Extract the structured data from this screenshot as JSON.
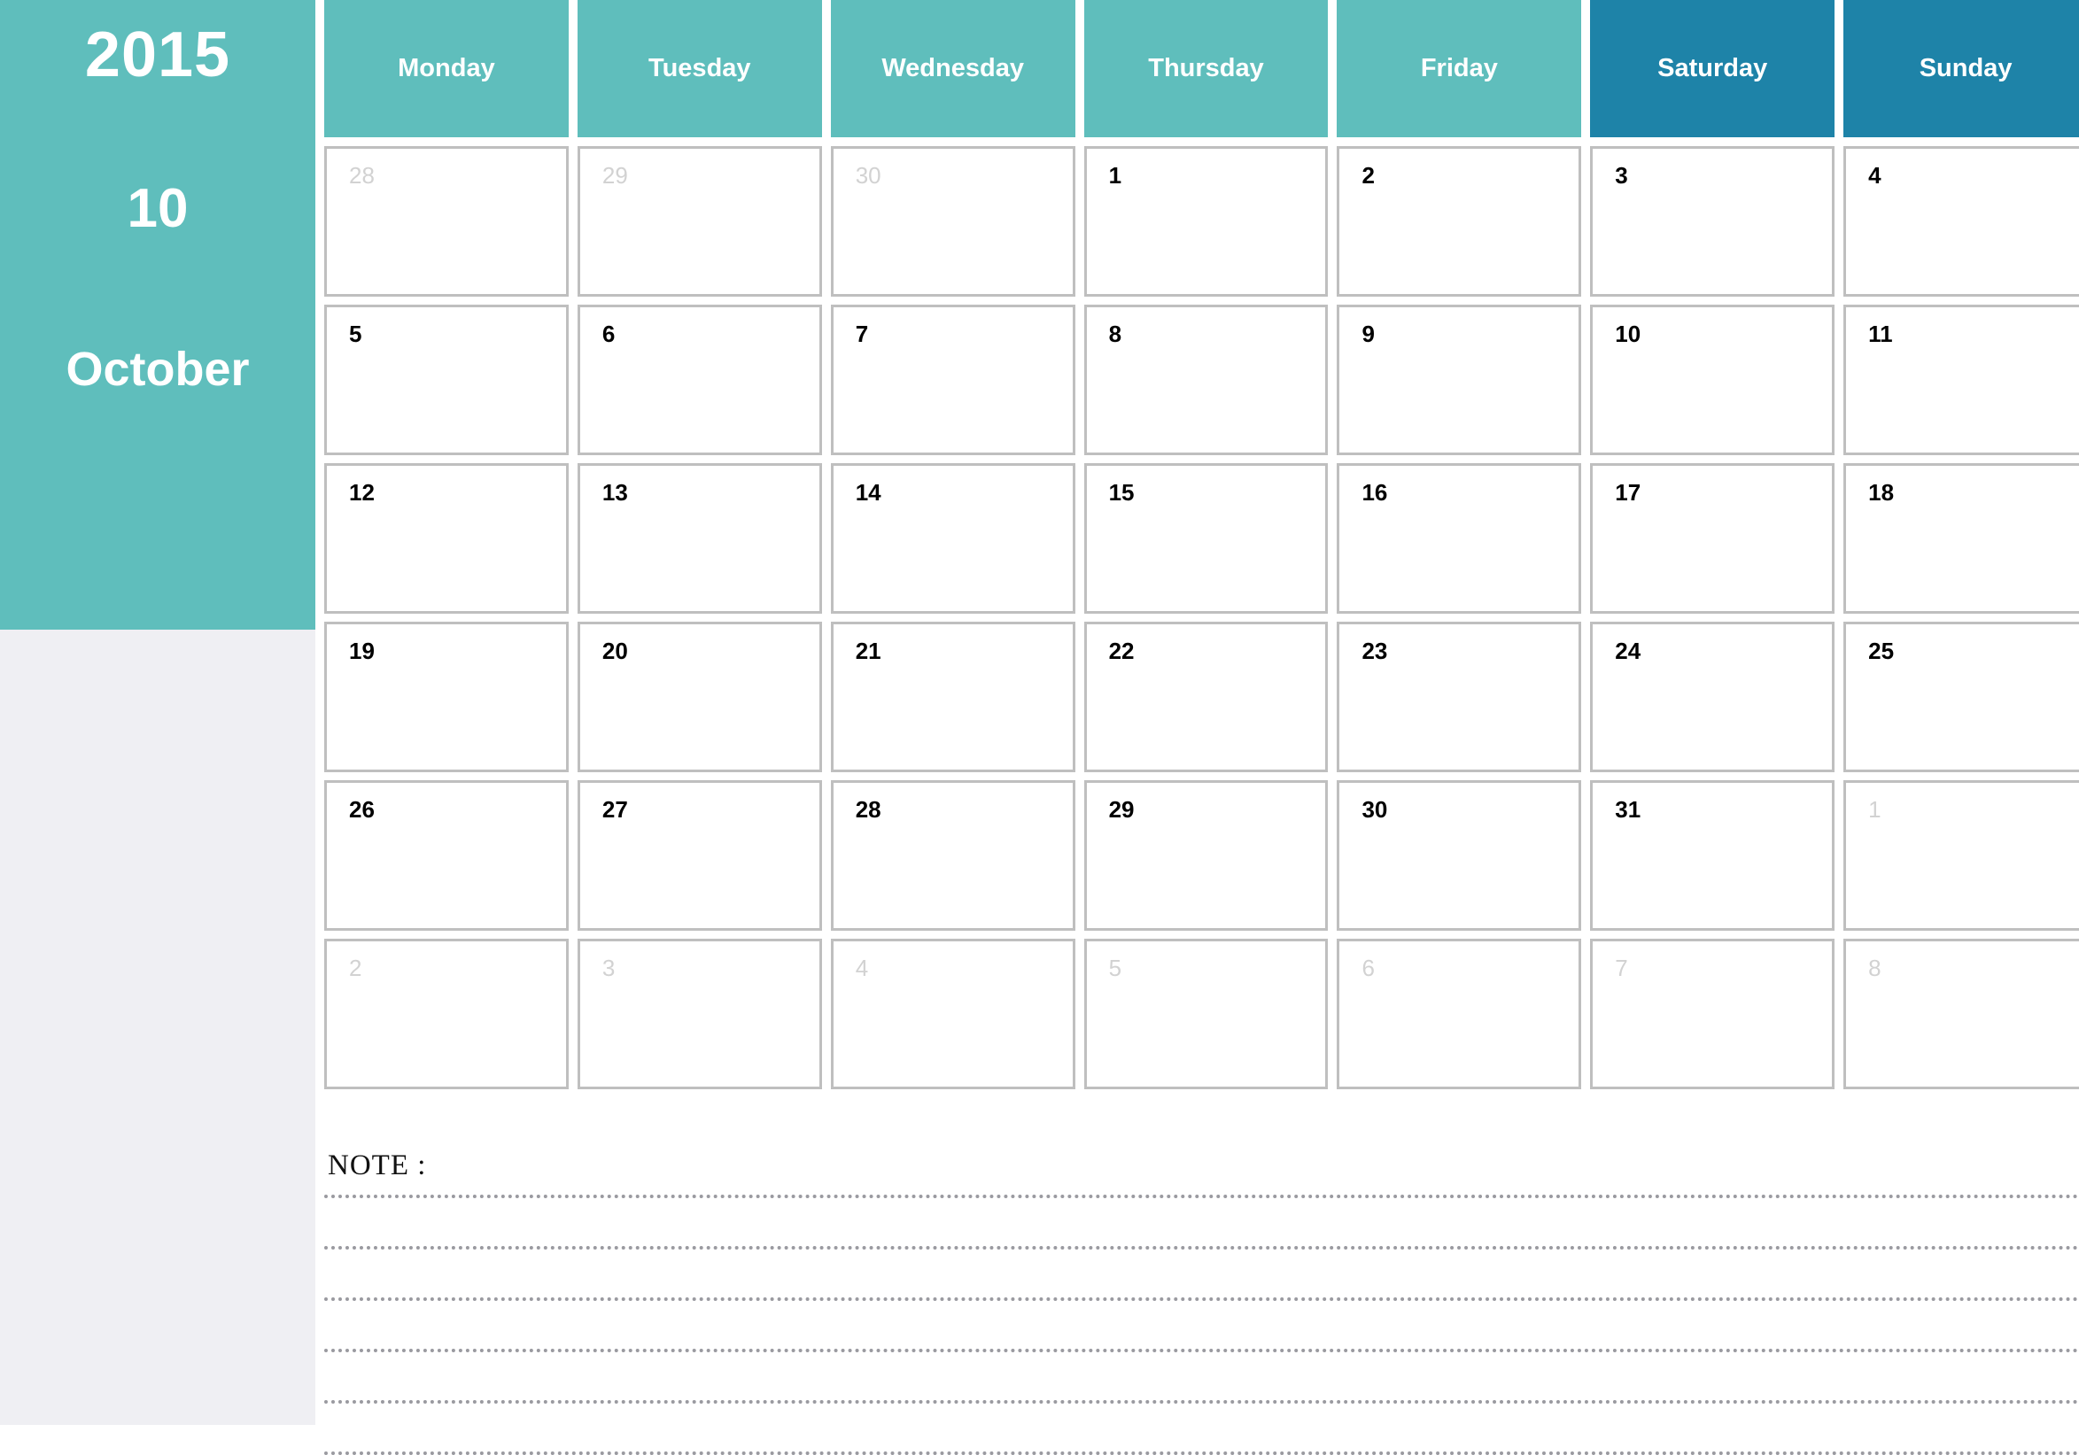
{
  "sidebar": {
    "year": "2015",
    "month_number": "10",
    "month_name": "October"
  },
  "colors": {
    "weekday_header": "#5FBEBC",
    "weekend_header": "#1E83A8",
    "sidebar_bg": "#5FBEBC",
    "sidebar_lower_bg": "#EFEFF3",
    "cell_border": "#BFBFBF",
    "day_number": "#000000",
    "outside_day_number": "#D2D2D2",
    "note_line": "#9A9AA0"
  },
  "weekdays": [
    {
      "label": "Monday",
      "weekend": false
    },
    {
      "label": "Tuesday",
      "weekend": false
    },
    {
      "label": "Wednesday",
      "weekend": false
    },
    {
      "label": "Thursday",
      "weekend": false
    },
    {
      "label": "Friday",
      "weekend": false
    },
    {
      "label": "Saturday",
      "weekend": true
    },
    {
      "label": "Sunday",
      "weekend": true
    }
  ],
  "weeks": [
    [
      {
        "day": "28",
        "outside": true
      },
      {
        "day": "29",
        "outside": true
      },
      {
        "day": "30",
        "outside": true
      },
      {
        "day": "1",
        "outside": false
      },
      {
        "day": "2",
        "outside": false
      },
      {
        "day": "3",
        "outside": false
      },
      {
        "day": "4",
        "outside": false
      }
    ],
    [
      {
        "day": "5",
        "outside": false
      },
      {
        "day": "6",
        "outside": false
      },
      {
        "day": "7",
        "outside": false
      },
      {
        "day": "8",
        "outside": false
      },
      {
        "day": "9",
        "outside": false
      },
      {
        "day": "10",
        "outside": false
      },
      {
        "day": "11",
        "outside": false
      }
    ],
    [
      {
        "day": "12",
        "outside": false
      },
      {
        "day": "13",
        "outside": false
      },
      {
        "day": "14",
        "outside": false
      },
      {
        "day": "15",
        "outside": false
      },
      {
        "day": "16",
        "outside": false
      },
      {
        "day": "17",
        "outside": false
      },
      {
        "day": "18",
        "outside": false
      }
    ],
    [
      {
        "day": "19",
        "outside": false
      },
      {
        "day": "20",
        "outside": false
      },
      {
        "day": "21",
        "outside": false
      },
      {
        "day": "22",
        "outside": false
      },
      {
        "day": "23",
        "outside": false
      },
      {
        "day": "24",
        "outside": false
      },
      {
        "day": "25",
        "outside": false
      }
    ],
    [
      {
        "day": "26",
        "outside": false
      },
      {
        "day": "27",
        "outside": false
      },
      {
        "day": "28",
        "outside": false
      },
      {
        "day": "29",
        "outside": false
      },
      {
        "day": "30",
        "outside": false
      },
      {
        "day": "31",
        "outside": false
      },
      {
        "day": "1",
        "outside": true
      }
    ],
    [
      {
        "day": "2",
        "outside": true
      },
      {
        "day": "3",
        "outside": true
      },
      {
        "day": "4",
        "outside": true
      },
      {
        "day": "5",
        "outside": true
      },
      {
        "day": "6",
        "outside": true
      },
      {
        "day": "7",
        "outside": true
      },
      {
        "day": "8",
        "outside": true
      }
    ]
  ],
  "note": {
    "label": "NOTE :",
    "line_count": 6,
    "line_tops": [
      59,
      117,
      175,
      233,
      291,
      349
    ]
  }
}
